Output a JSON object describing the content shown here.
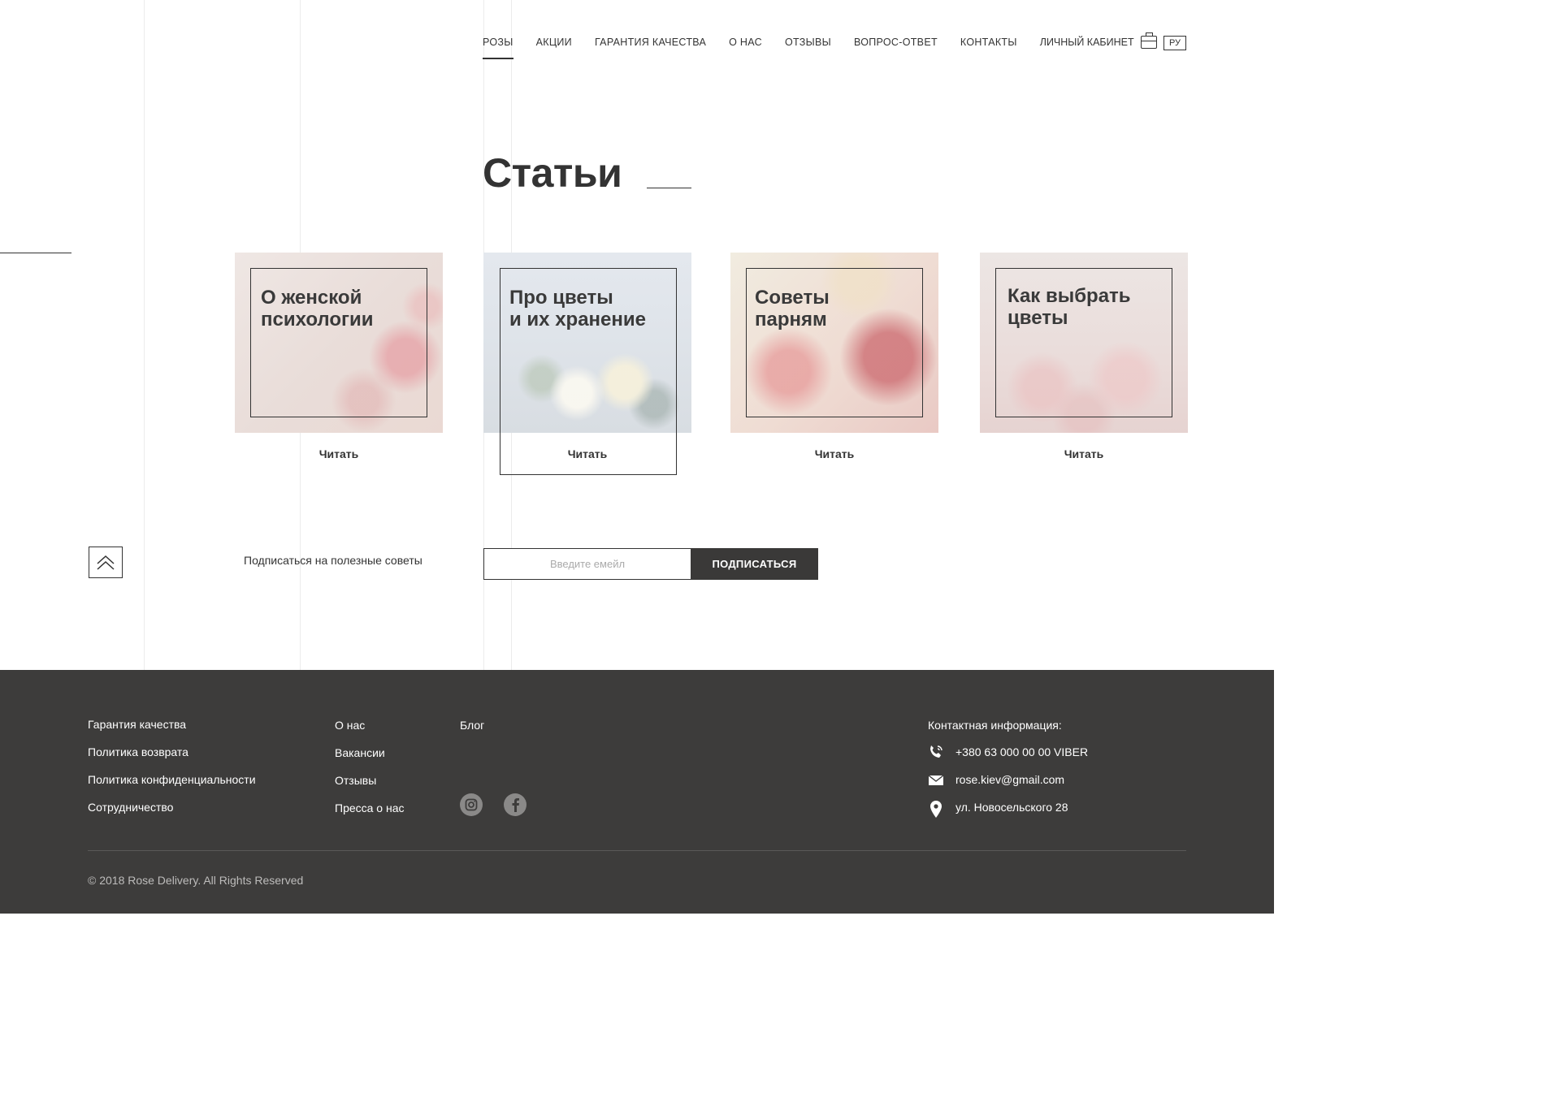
{
  "nav": {
    "items": [
      "РОЗЫ",
      "АКЦИИ",
      "ГАРАНТИЯ КАЧЕСТВА",
      "О НАС",
      "ОТЗЫВЫ",
      "ВОПРОС-ОТВЕТ",
      "КОНТАКТЫ"
    ],
    "cabinet": "ЛИЧНЫЙ КАБИНЕТ",
    "lang": "РУ"
  },
  "main": {
    "title": "Статьи",
    "cards": [
      {
        "title": "О женской\nпсихологии",
        "read": "Читать"
      },
      {
        "title": "Про цветы\nи их хранение",
        "read": "Читать"
      },
      {
        "title": "Советы\nпарням",
        "read": "Читать"
      },
      {
        "title": "Как выбрать\nцветы",
        "read": "Читать"
      }
    ]
  },
  "subscribe": {
    "label": "Подписаться на полезные советы",
    "placeholder": "Введите емейл",
    "button": "ПОДПИСАТЬСЯ"
  },
  "footer": {
    "col1": [
      "Гарантия качества",
      "Политика возврата",
      "Политика конфиденциальности",
      "Сотрудничество"
    ],
    "col2": [
      "О нас",
      "Вакансии",
      "Отзывы",
      "Пресса о нас"
    ],
    "col3": [
      "Блог"
    ],
    "contact_title": "Контактная информация:",
    "phone": "+380 63 000 00 00  VIBER",
    "email": "rose.kiev@gmail.com",
    "address": "ул. Новосельского 28",
    "copyright": "© 2018  Rose Delivery.  All Rights Reserved"
  },
  "icons": [
    "briefcase-icon",
    "double-chevron-up-icon",
    "instagram-icon",
    "facebook-icon",
    "phone-icon",
    "mail-icon",
    "location-pin-icon"
  ],
  "colors": {
    "text": "#333333",
    "footer_bg": "#3d3c3b",
    "button_bg": "#3a3938"
  }
}
